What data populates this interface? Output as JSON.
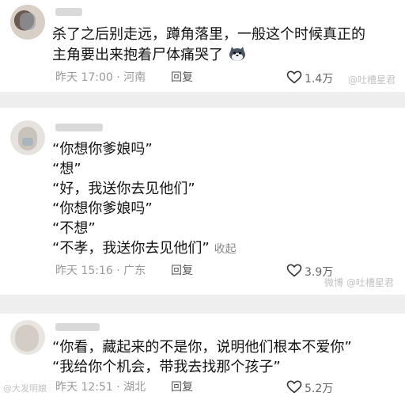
{
  "comments": [
    {
      "lines": [
        "杀了之后别走远，蹲角落里，一般这个时候真正的",
        "主角要出来抱着尸体痛哭了"
      ],
      "emoji": "cat-emoji",
      "meta": "昨天 17:00 · 河南",
      "reply": "回复",
      "likes": "1.4万"
    },
    {
      "lines": [
        "“你想你爹娘吗”",
        "“想”",
        "“好，我送你去见他们”",
        "“你想你爹娘吗”",
        "“不想”",
        "“不孝，我送你去见他们”"
      ],
      "collapse": "收起",
      "meta": "昨天 15:16 · 广东",
      "reply": "回复",
      "likes": "3.9万"
    },
    {
      "lines": [
        "“你看，藏起来的不是你，说明他们根本不爱你”",
        "“我给你个机会，带我去找那个孩子”"
      ],
      "meta": "昨天 12:51 · 湖北",
      "reply": "回复",
      "likes": "5.2万"
    }
  ],
  "watermarks": [
    "@吐槽星君",
    "微博 @吐槽星君",
    "@大发明娘"
  ],
  "colors": {
    "separator": "#eeeeee",
    "text": "#121212",
    "meta": "#9a9a9a"
  }
}
